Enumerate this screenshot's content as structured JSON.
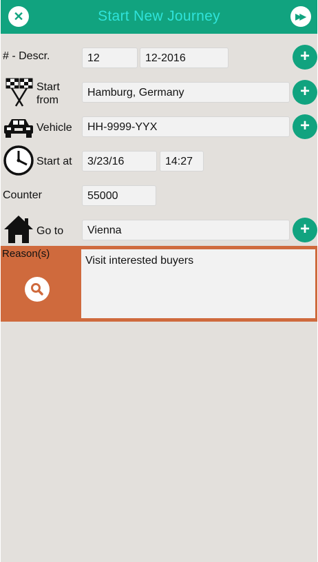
{
  "header": {
    "title": "Start New Journey",
    "close_icon": "close-icon",
    "next_icon": "fast-forward-icon",
    "accent": "#11a37f",
    "title_color": "#2fe3da"
  },
  "form": {
    "descr": {
      "label": "# - Descr.",
      "number": "12",
      "code": "12-2016"
    },
    "start_from": {
      "label_line1": "Start",
      "label_line2": "from",
      "value": "Hamburg, Germany",
      "icon": "checkered-flags-icon"
    },
    "vehicle": {
      "label": "Vehicle",
      "value": "HH-9999-YYX",
      "icon": "car-icon"
    },
    "start_at": {
      "label": "Start at",
      "date": "3/23/16",
      "time": "14:27",
      "icon": "clock-icon"
    },
    "counter": {
      "label": "Counter",
      "value": "55000"
    },
    "go_to": {
      "label": "Go to",
      "value": "Vienna",
      "icon": "house-icon"
    },
    "reasons": {
      "label": "Reason(s)",
      "value": "Visit interested buyers",
      "panel_color": "#cf6a3d"
    }
  }
}
